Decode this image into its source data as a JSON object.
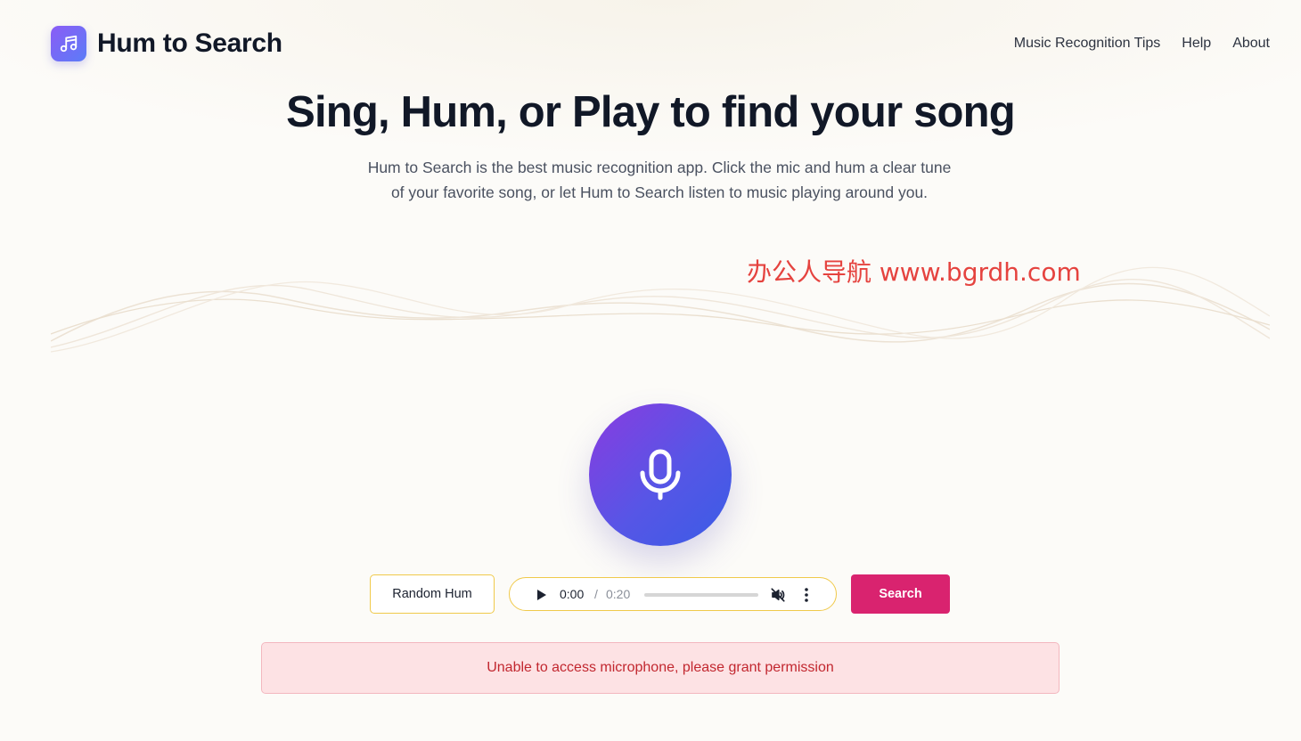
{
  "header": {
    "brand": "Hum to Search",
    "logo_icon": "music-note-icon",
    "nav": [
      {
        "label": "Music Recognition Tips"
      },
      {
        "label": "Help"
      },
      {
        "label": "About"
      }
    ]
  },
  "hero": {
    "title": "Sing, Hum, or Play to find your song",
    "subtitle_line1": "Hum to Search is the best music recognition app. Click the mic and hum a clear tune",
    "subtitle_line2": "of your favorite song, or let Hum to Search listen to music playing around you."
  },
  "watermark": "办公人导航 www.bgrdh.com",
  "mic": {
    "icon": "microphone-icon"
  },
  "controls": {
    "random_label": "Random Hum",
    "audio": {
      "current_time": "0:00",
      "separator": "/",
      "duration": "0:20",
      "progress": 0,
      "play_icon": "play-icon",
      "volume_icon": "volume-muted-icon",
      "more_icon": "more-vertical-icon"
    },
    "search_label": "Search"
  },
  "error": {
    "message": "Unable to access microphone, please grant permission"
  },
  "colors": {
    "accent_pink": "#d9236f",
    "mic_gradient_start": "#8a3be0",
    "mic_gradient_end": "#3a5ce6",
    "error_bg": "#fde2e4",
    "error_text": "#c2272f",
    "button_border": "#f0c94a"
  }
}
